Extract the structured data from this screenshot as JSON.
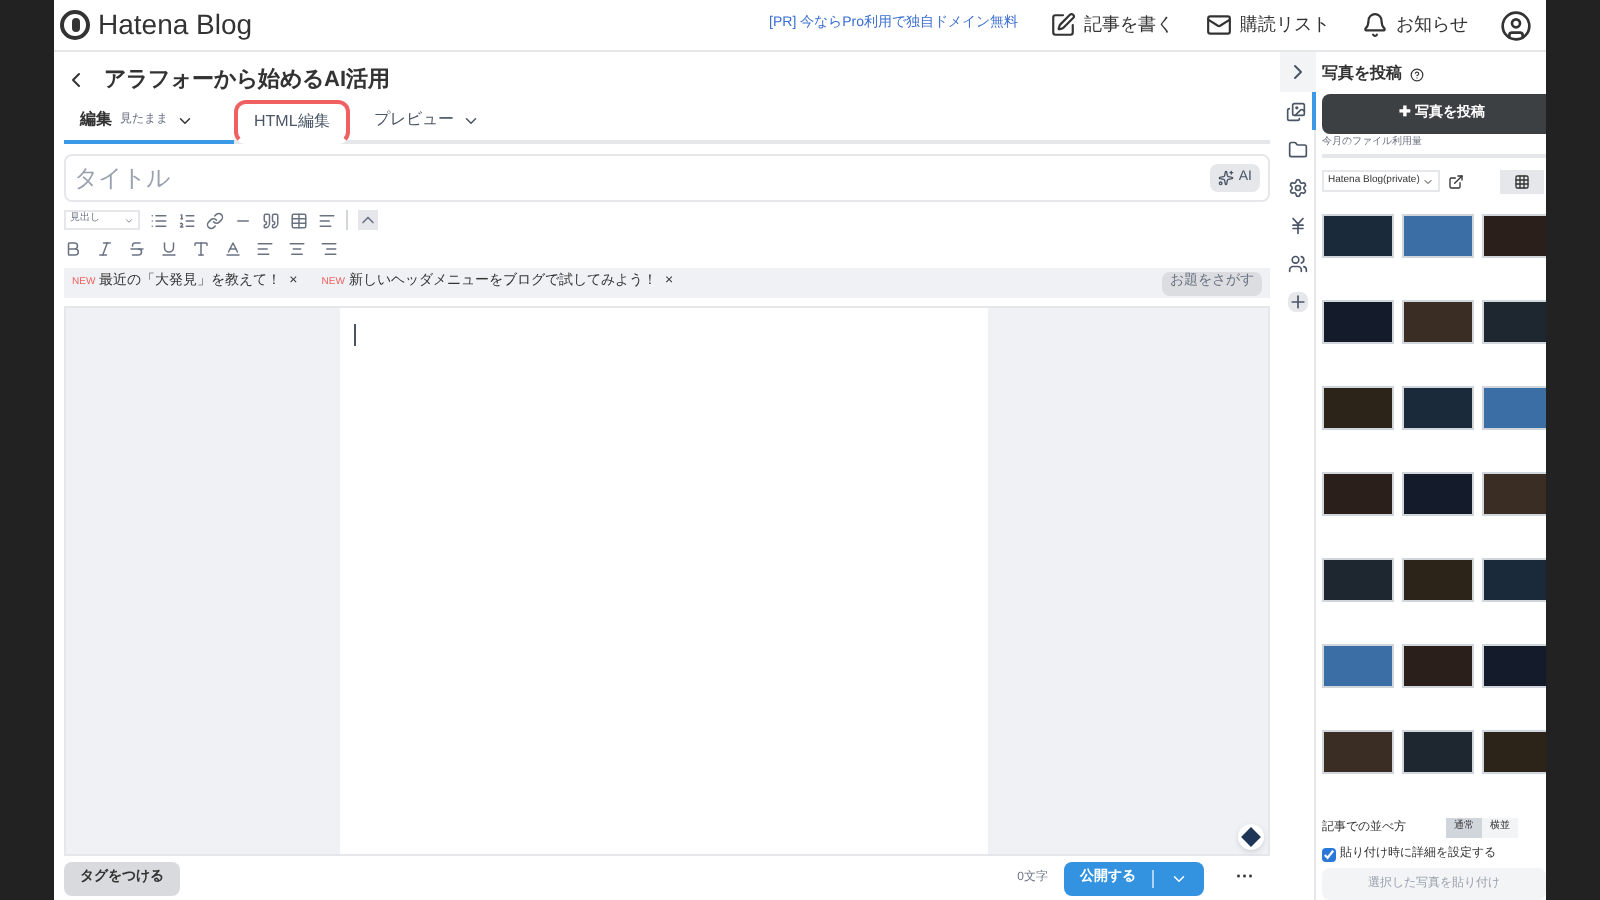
{
  "header": {
    "brand": "Hatena Blog",
    "promo": "[PR] 今ならPro利用で独自ドメイン無料",
    "nav": [
      {
        "kind": "write",
        "label": "記事を書く"
      },
      {
        "kind": "reading",
        "label": "購読リスト"
      },
      {
        "kind": "bell",
        "label": "お知らせ"
      }
    ]
  },
  "article_title": "アラフォーから始めるAI活用",
  "tabs": [
    {
      "label": "編集",
      "sub": "見たまま",
      "selected": true,
      "highlighted": false,
      "dropdown": true
    },
    {
      "label": "HTML編集",
      "selected": false,
      "highlighted": true,
      "dropdown": false
    },
    {
      "label": "プレビュー",
      "selected": false,
      "highlighted": false,
      "dropdown": true
    }
  ],
  "title_field": {
    "placeholder": "タイトル",
    "ai_button": "AI"
  },
  "toolbar": {
    "heading_select": "見出し"
  },
  "topics": [
    {
      "badge": "NEW",
      "label": "最近の「大発見」を教えて！",
      "close": "×"
    },
    {
      "badge": "NEW",
      "label": "新しいヘッダメニューをブログで試してみよう！",
      "close": "×"
    }
  ],
  "topic_search": "お題をさがす",
  "footer": {
    "tag_button": "タグをつける",
    "char_count": "0文字",
    "publish": "公開する",
    "more": "···"
  },
  "side_icons": [
    {
      "kind": "photos",
      "selected": true
    },
    {
      "kind": "folder",
      "selected": false
    },
    {
      "kind": "gear",
      "selected": false
    },
    {
      "kind": "yen",
      "selected": false
    },
    {
      "kind": "people",
      "selected": false
    },
    {
      "kind": "plus",
      "selected": false
    }
  ],
  "photo_panel": {
    "title": "写真を投稿",
    "upload_button": "✚ 写真を投稿",
    "usage_label": "今月のファイル利用量",
    "blog_select": "Hatena Blog(private)",
    "layout_label": "記事での並べ方",
    "layout_options": [
      {
        "label": "通常",
        "selected": true
      },
      {
        "label": "横並",
        "selected": false
      }
    ],
    "detail_checkbox": {
      "label": "貼り付け時に詳細を設定する",
      "checked": true
    },
    "paste_button": {
      "label": "選択した写真を貼り付け",
      "disabled": true
    }
  }
}
